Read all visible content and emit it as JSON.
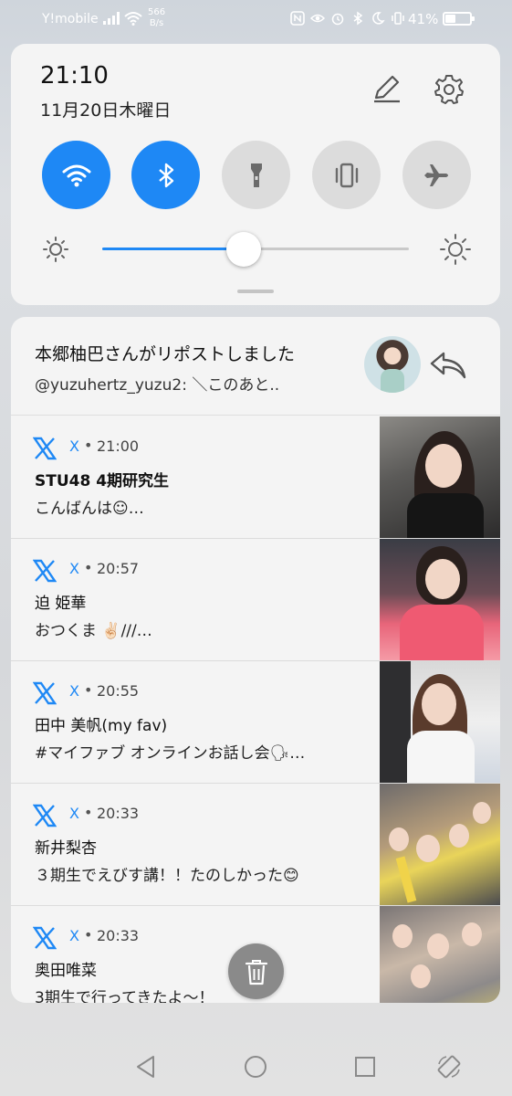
{
  "status_bar": {
    "carrier": "Y!mobile",
    "speed_value": "566",
    "speed_unit": "B/s",
    "battery_percent": "41%",
    "battery_level": 0.41,
    "icons": [
      "signal-icon",
      "wifi-icon",
      "nfc-icon",
      "eye-comfort-icon",
      "alarm-icon",
      "bluetooth-icon",
      "moon-icon",
      "vibrate-icon"
    ]
  },
  "quick_settings": {
    "time": "21:10",
    "date": "11月20日木曜日",
    "tiles": [
      {
        "name": "wifi",
        "icon": "wifi-icon",
        "state": "on"
      },
      {
        "name": "bluetooth",
        "icon": "bluetooth-icon",
        "state": "on"
      },
      {
        "name": "flashlight",
        "icon": "flashlight-icon",
        "state": "off"
      },
      {
        "name": "vibrate",
        "icon": "vibrate-icon",
        "state": "off"
      },
      {
        "name": "airplane",
        "icon": "airplane-icon",
        "state": "off"
      }
    ],
    "brightness_level": 0.46,
    "accent_color": "#1e88f5"
  },
  "notifications": {
    "header": {
      "title": "本郷柚巴さんがリポストしました",
      "subtitle": "@yuzuhertz_yuzu2: ＼このあと.."
    },
    "items": [
      {
        "app": "X",
        "separator": "•",
        "time": "21:00",
        "name": "STU48 4期研究生",
        "message": "こんばんは☺︎…"
      },
      {
        "app": "X",
        "separator": "•",
        "time": "20:57",
        "name": "迫 姫華",
        "message": "おつくま ✌🏻///…"
      },
      {
        "app": "X",
        "separator": "•",
        "time": "20:55",
        "name": "田中 美帆(my fav)",
        "message": "#マイファブ オンラインお話し会🗣…"
      },
      {
        "app": "X",
        "separator": "•",
        "time": "20:33",
        "name": "新井梨杏",
        "message": "３期生でえびす講！！たのしかった😊"
      },
      {
        "app": "X",
        "separator": "•",
        "time": "20:33",
        "name": "奥田唯菜",
        "message": "3期生で行ってきたよ〜！"
      }
    ]
  },
  "nav_bar": {
    "buttons": [
      "back-icon",
      "home-icon",
      "recents-icon",
      "rotate-icon"
    ]
  }
}
